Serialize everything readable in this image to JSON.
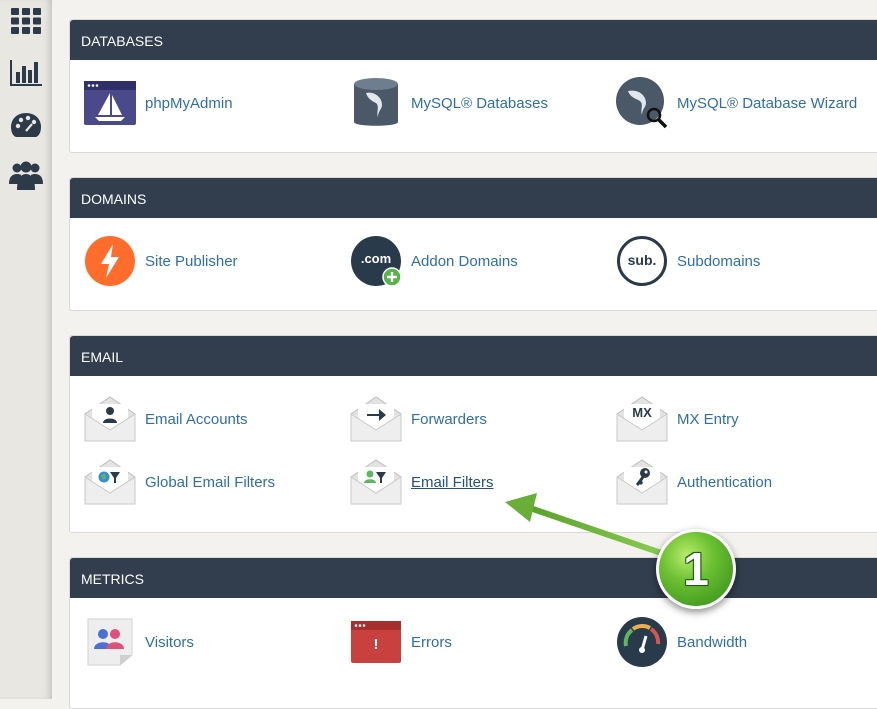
{
  "sidebar": {
    "icons": [
      "grid-icon",
      "bar-chart-icon",
      "palette-icon",
      "users-icon"
    ]
  },
  "sections": {
    "databases": {
      "title": "DATABASES",
      "items": [
        {
          "label": "phpMyAdmin",
          "icon": "phpmyadmin-icon"
        },
        {
          "label": "MySQL® Databases",
          "icon": "mysql-databases-icon"
        },
        {
          "label": "MySQL® Database Wizard",
          "icon": "mysql-wizard-icon"
        }
      ]
    },
    "domains": {
      "title": "DOMAINS",
      "items": [
        {
          "label": "Site Publisher",
          "icon": "site-publisher-icon"
        },
        {
          "label": "Addon Domains",
          "icon": "addon-domains-icon",
          "icon_text": ".com"
        },
        {
          "label": "Subdomains",
          "icon": "subdomains-icon",
          "icon_text": "sub."
        }
      ]
    },
    "email": {
      "title": "EMAIL",
      "items": [
        {
          "label": "Email Accounts",
          "icon": "email-accounts-icon"
        },
        {
          "label": "Forwarders",
          "icon": "forwarders-icon"
        },
        {
          "label": "MX Entry",
          "icon": "mx-entry-icon",
          "icon_text": "MX"
        },
        {
          "label": "Global Email Filters",
          "icon": "global-email-filters-icon"
        },
        {
          "label": "Email Filters",
          "icon": "email-filters-icon"
        },
        {
          "label": "Authentication",
          "icon": "authentication-icon"
        }
      ]
    },
    "metrics": {
      "title": "METRICS",
      "items": [
        {
          "label": "Visitors",
          "icon": "visitors-icon"
        },
        {
          "label": "Errors",
          "icon": "errors-icon",
          "icon_text": "!"
        },
        {
          "label": "Bandwidth",
          "icon": "bandwidth-icon"
        }
      ]
    }
  },
  "annotation": {
    "badge_number": "1",
    "colors": {
      "arrow": "#6aae3a",
      "badge": "#3f9a1f"
    }
  }
}
